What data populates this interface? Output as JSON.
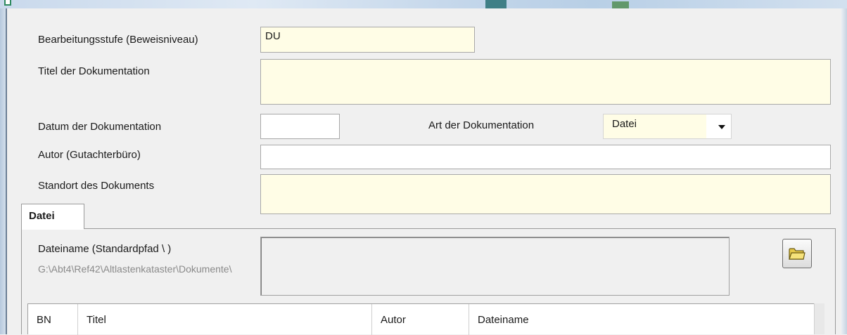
{
  "form": {
    "bearbeitungsstufe": {
      "label": "Bearbeitungsstufe (Beweisniveau)",
      "value": "DU"
    },
    "titel": {
      "label": "Titel der Dokumentation",
      "value": ""
    },
    "datum": {
      "label": "Datum der  Dokumentation",
      "value": ""
    },
    "art": {
      "label": "Art der  Dokumentation",
      "value": "Datei"
    },
    "autor": {
      "label": "Autor (Gutachterbüro)",
      "value": ""
    },
    "standort": {
      "label": "Standort des Dokuments",
      "value": ""
    }
  },
  "tabs": [
    {
      "label": "Datei",
      "active": true
    }
  ],
  "datei": {
    "dateiname_label": "Dateiname  (Standardpfad \\ )",
    "standardpfad": "G:\\Abt4\\Ref42\\Altlastenkataster\\Dokumente\\",
    "dateiname_value": "",
    "browse_icon": "folder-icon"
  },
  "grid": {
    "columns": [
      "BN",
      "Titel",
      "Autor",
      "Dateiname"
    ]
  },
  "colors": {
    "required_field": "#fffde6",
    "window_bg": "#f0f0f0"
  }
}
